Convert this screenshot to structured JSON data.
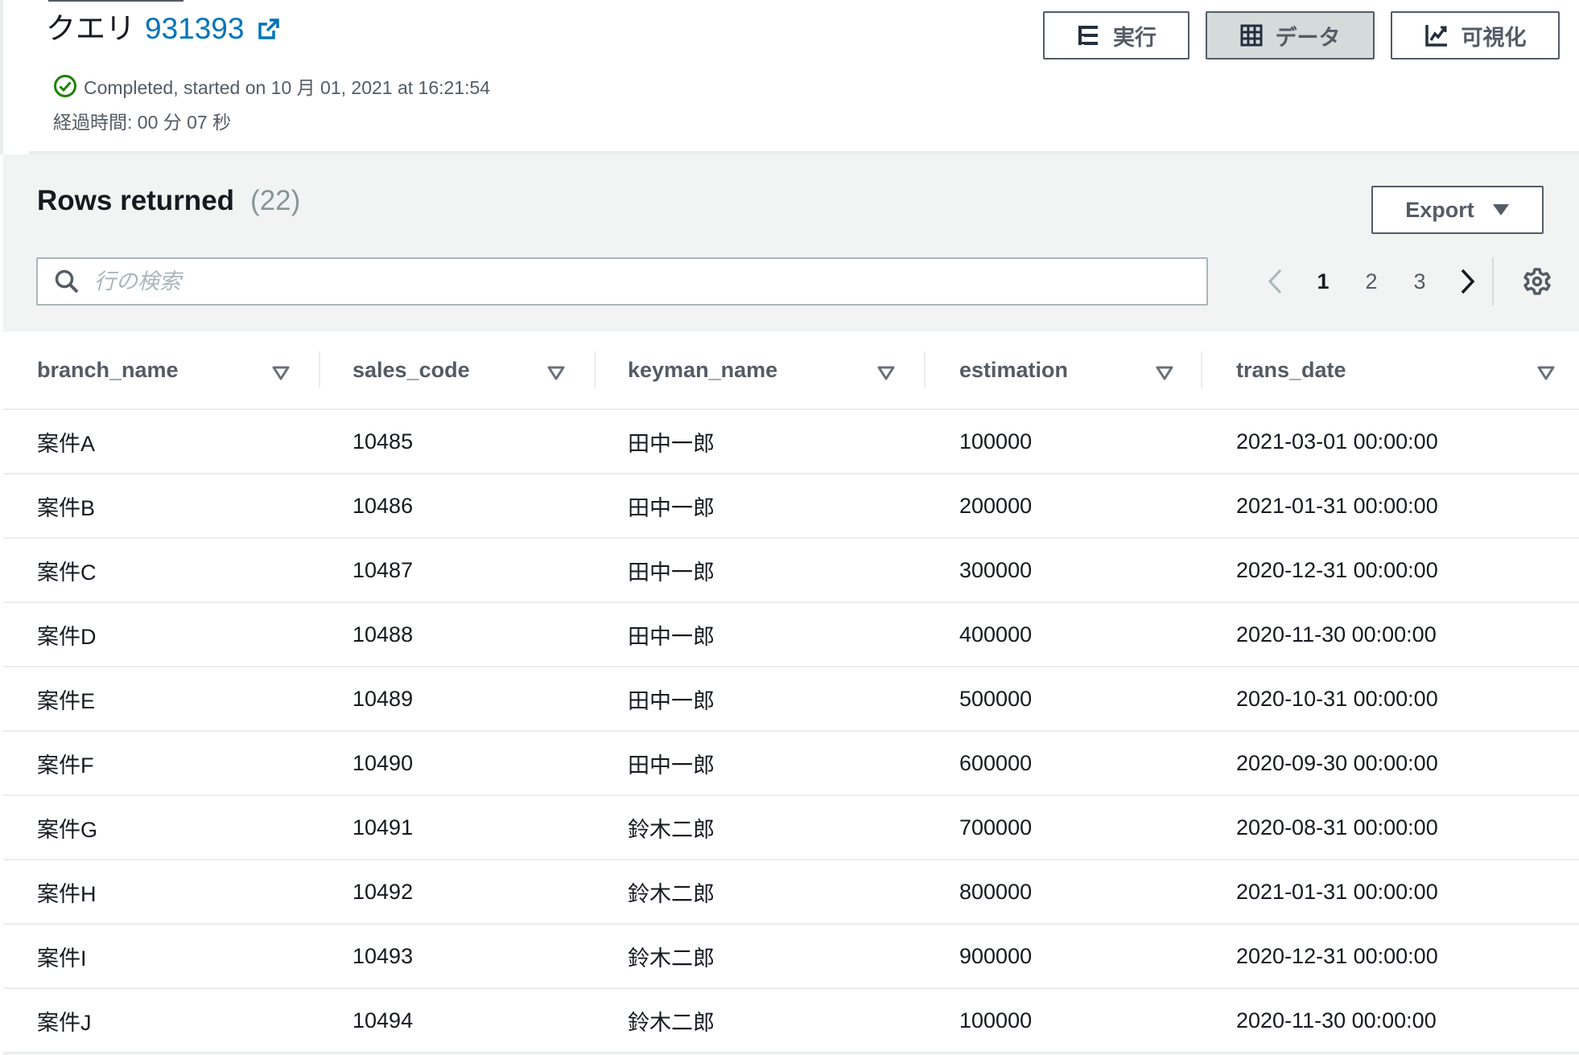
{
  "header": {
    "title_prefix": "クエリ",
    "query_id": "931393",
    "status": "Completed, started on 10 月 01, 2021 at 16:21:54",
    "elapsed": "経過時間: 00 分 07 秒",
    "buttons": {
      "run": "実行",
      "data": "データ",
      "visualize": "可視化"
    },
    "colors": {
      "link": "#0073bb",
      "success": "#1d8102",
      "selected_bg": "#d5dbdb"
    }
  },
  "rows_panel": {
    "title": "Rows returned",
    "count": "(22)",
    "export_label": "Export",
    "search_placeholder": "行の検索",
    "pagination": {
      "pages": [
        "1",
        "2",
        "3"
      ],
      "current": "1"
    }
  },
  "table": {
    "columns": [
      "branch_name",
      "sales_code",
      "keyman_name",
      "estimation",
      "trans_date"
    ],
    "rows": [
      [
        "案件A",
        "10485",
        "田中一郎",
        "100000",
        "2021-03-01 00:00:00"
      ],
      [
        "案件B",
        "10486",
        "田中一郎",
        "200000",
        "2021-01-31 00:00:00"
      ],
      [
        "案件C",
        "10487",
        "田中一郎",
        "300000",
        "2020-12-31 00:00:00"
      ],
      [
        "案件D",
        "10488",
        "田中一郎",
        "400000",
        "2020-11-30 00:00:00"
      ],
      [
        "案件E",
        "10489",
        "田中一郎",
        "500000",
        "2020-10-31 00:00:00"
      ],
      [
        "案件F",
        "10490",
        "田中一郎",
        "600000",
        "2020-09-30 00:00:00"
      ],
      [
        "案件G",
        "10491",
        "鈴木二郎",
        "700000",
        "2020-08-31 00:00:00"
      ],
      [
        "案件H",
        "10492",
        "鈴木二郎",
        "800000",
        "2021-01-31 00:00:00"
      ],
      [
        "案件I",
        "10493",
        "鈴木二郎",
        "900000",
        "2020-12-31 00:00:00"
      ],
      [
        "案件J",
        "10494",
        "鈴木二郎",
        "100000",
        "2020-11-30 00:00:00"
      ]
    ]
  },
  "icons": {
    "external_link": "external-link-icon",
    "status": "check-circle-icon",
    "run": "list-tree-icon",
    "data": "grid-icon",
    "visualize": "line-chart-icon",
    "export_caret": "caret-down-icon",
    "search": "search-icon",
    "prev": "chevron-left-icon",
    "next": "chevron-right-icon",
    "settings": "gear-icon",
    "sort": "sort-triangle-icon"
  }
}
